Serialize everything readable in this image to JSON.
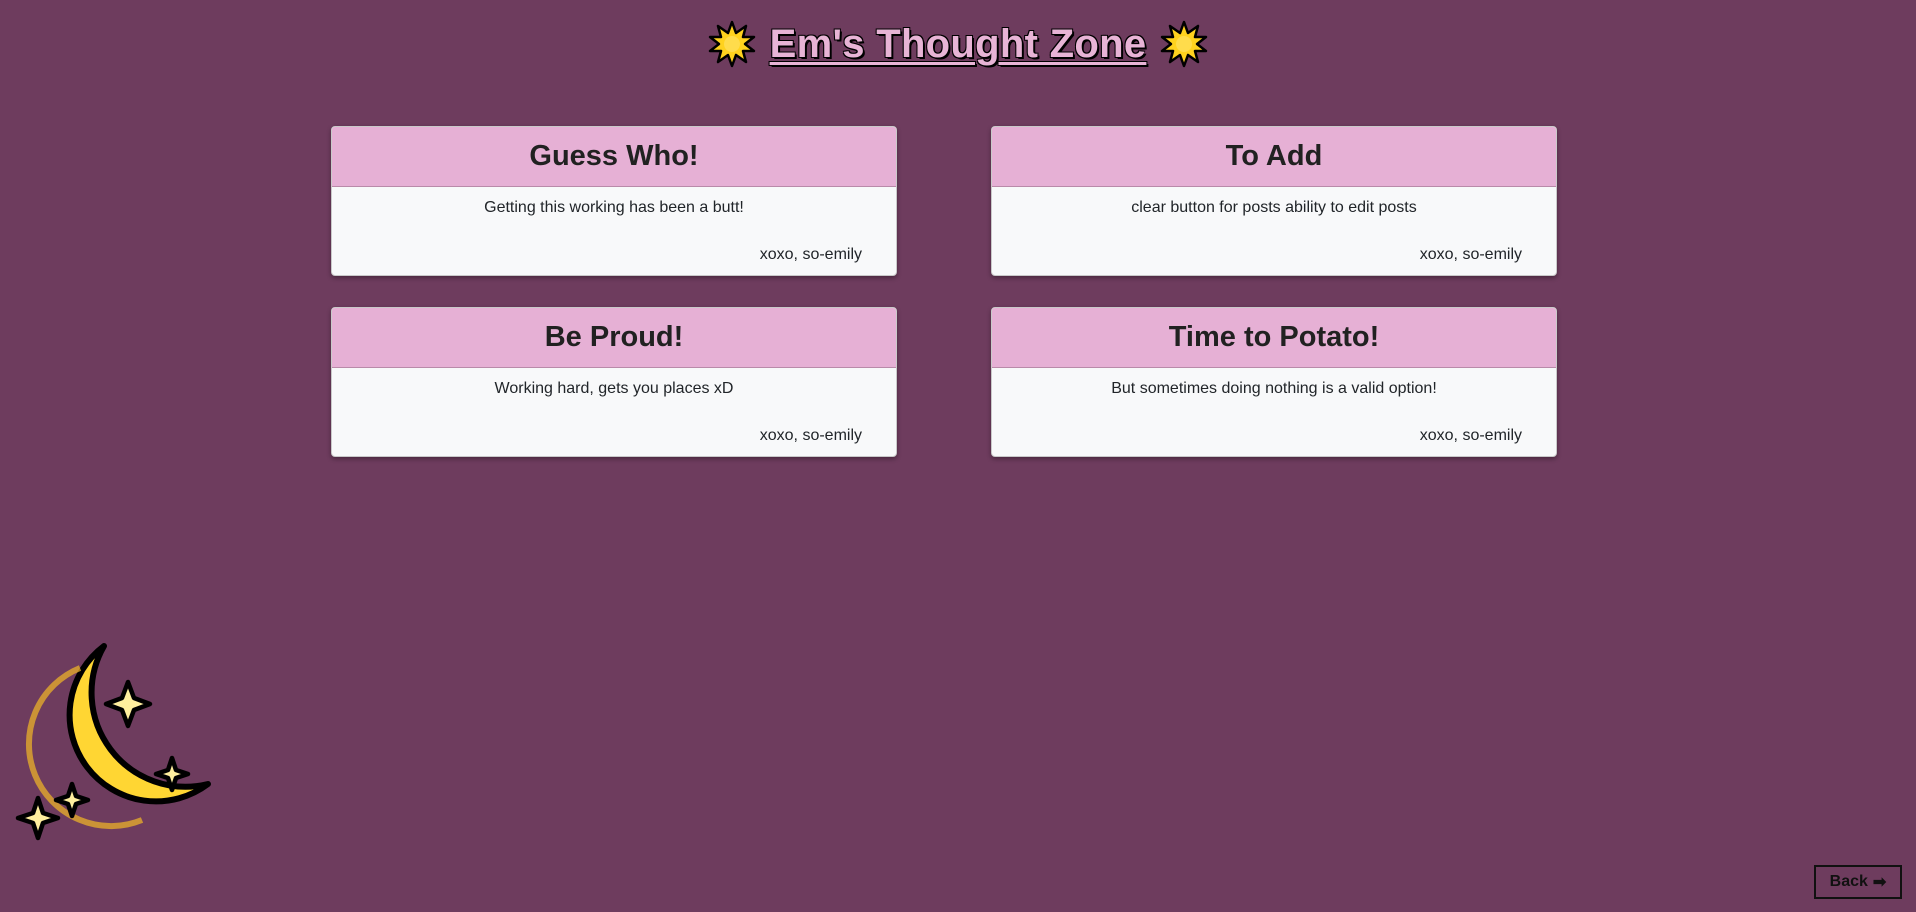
{
  "header": {
    "title": "Em's Thought Zone",
    "left_icon": "sun-icon",
    "right_icon": "sun-icon"
  },
  "posts": [
    {
      "title": "Guess Who!",
      "body": "Getting this working has been a butt!",
      "signature": "xoxo, so-emily"
    },
    {
      "title": "To Add",
      "body": "clear button for posts ability to edit posts",
      "signature": "xoxo, so-emily"
    },
    {
      "title": "Be Proud!",
      "body": "Working hard, gets you places xD",
      "signature": "xoxo, so-emily"
    },
    {
      "title": "Time to Potato!",
      "body": "But sometimes doing nothing is a valid option!",
      "signature": "xoxo, so-emily"
    }
  ],
  "decoration": {
    "icon": "moon-stars-icon"
  },
  "back_button": {
    "label": "Back",
    "icon": "arrow-right-icon"
  },
  "colors": {
    "background": "#6e3c5e",
    "card_header": "#e6b0d5",
    "title_text": "#e8b4d6",
    "moon": "#ffd633"
  }
}
